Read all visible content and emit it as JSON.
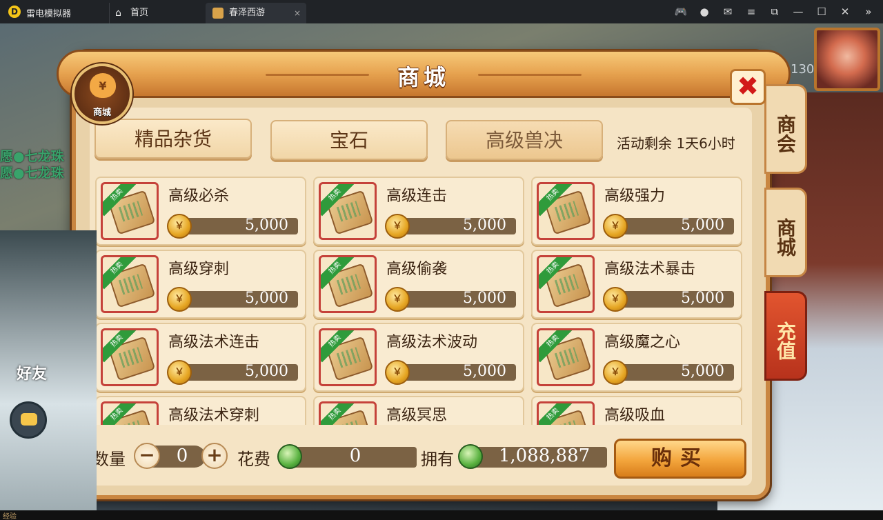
{
  "emulator": {
    "app_name": "雷电模拟器",
    "logo_glyph": "D",
    "tabs": [
      {
        "label": "首页",
        "icon": "home-icon"
      },
      {
        "label": "春泽西游",
        "icon": "game-icon",
        "close_glyph": "×"
      }
    ],
    "toolbar_icons": [
      "gamepad-icon",
      "account-icon",
      "mail-icon",
      "menu-icon",
      "popout-icon",
      "minimize-icon",
      "maximize-icon",
      "close-icon",
      "collapse-icon"
    ]
  },
  "game": {
    "side_texts": [
      "愿●七龙珠",
      "愿●七龙珠"
    ],
    "friends_label": "好友",
    "hp_number": "130",
    "exp_label": "经验"
  },
  "shop": {
    "title": "商城",
    "badge_glyph": "¥",
    "badge_label": "商城",
    "close_glyph": "✖",
    "side_tabs": [
      "商会",
      "商城",
      "充值"
    ],
    "categories": [
      "精品杂货",
      "宝石",
      "高级兽决"
    ],
    "active_category": "高级兽决",
    "timer_text": "活动剩余 1天6小时",
    "hot_tag": "热卖",
    "coin_glyph": "￥",
    "items": [
      {
        "name": "高级必杀",
        "price": "5,000"
      },
      {
        "name": "高级连击",
        "price": "5,000"
      },
      {
        "name": "高级强力",
        "price": "5,000"
      },
      {
        "name": "高级穿刺",
        "price": "5,000"
      },
      {
        "name": "高级偷袭",
        "price": "5,000"
      },
      {
        "name": "高级法术暴击",
        "price": "5,000"
      },
      {
        "name": "高级法术连击",
        "price": "5,000"
      },
      {
        "name": "高级法术波动",
        "price": "5,000"
      },
      {
        "name": "高级魔之心",
        "price": "5,000"
      },
      {
        "name": "高级法术穿刺",
        "price": ""
      },
      {
        "name": "高级冥思",
        "price": ""
      },
      {
        "name": "高级吸血",
        "price": ""
      }
    ],
    "footer": {
      "quantity_label": "数量",
      "minus": "−",
      "plus": "+",
      "quantity_value": "0",
      "cost_label": "花费",
      "cost_value": "0",
      "owned_label": "拥有",
      "owned_value": "1,088,887",
      "buy_label": "购买"
    }
  }
}
